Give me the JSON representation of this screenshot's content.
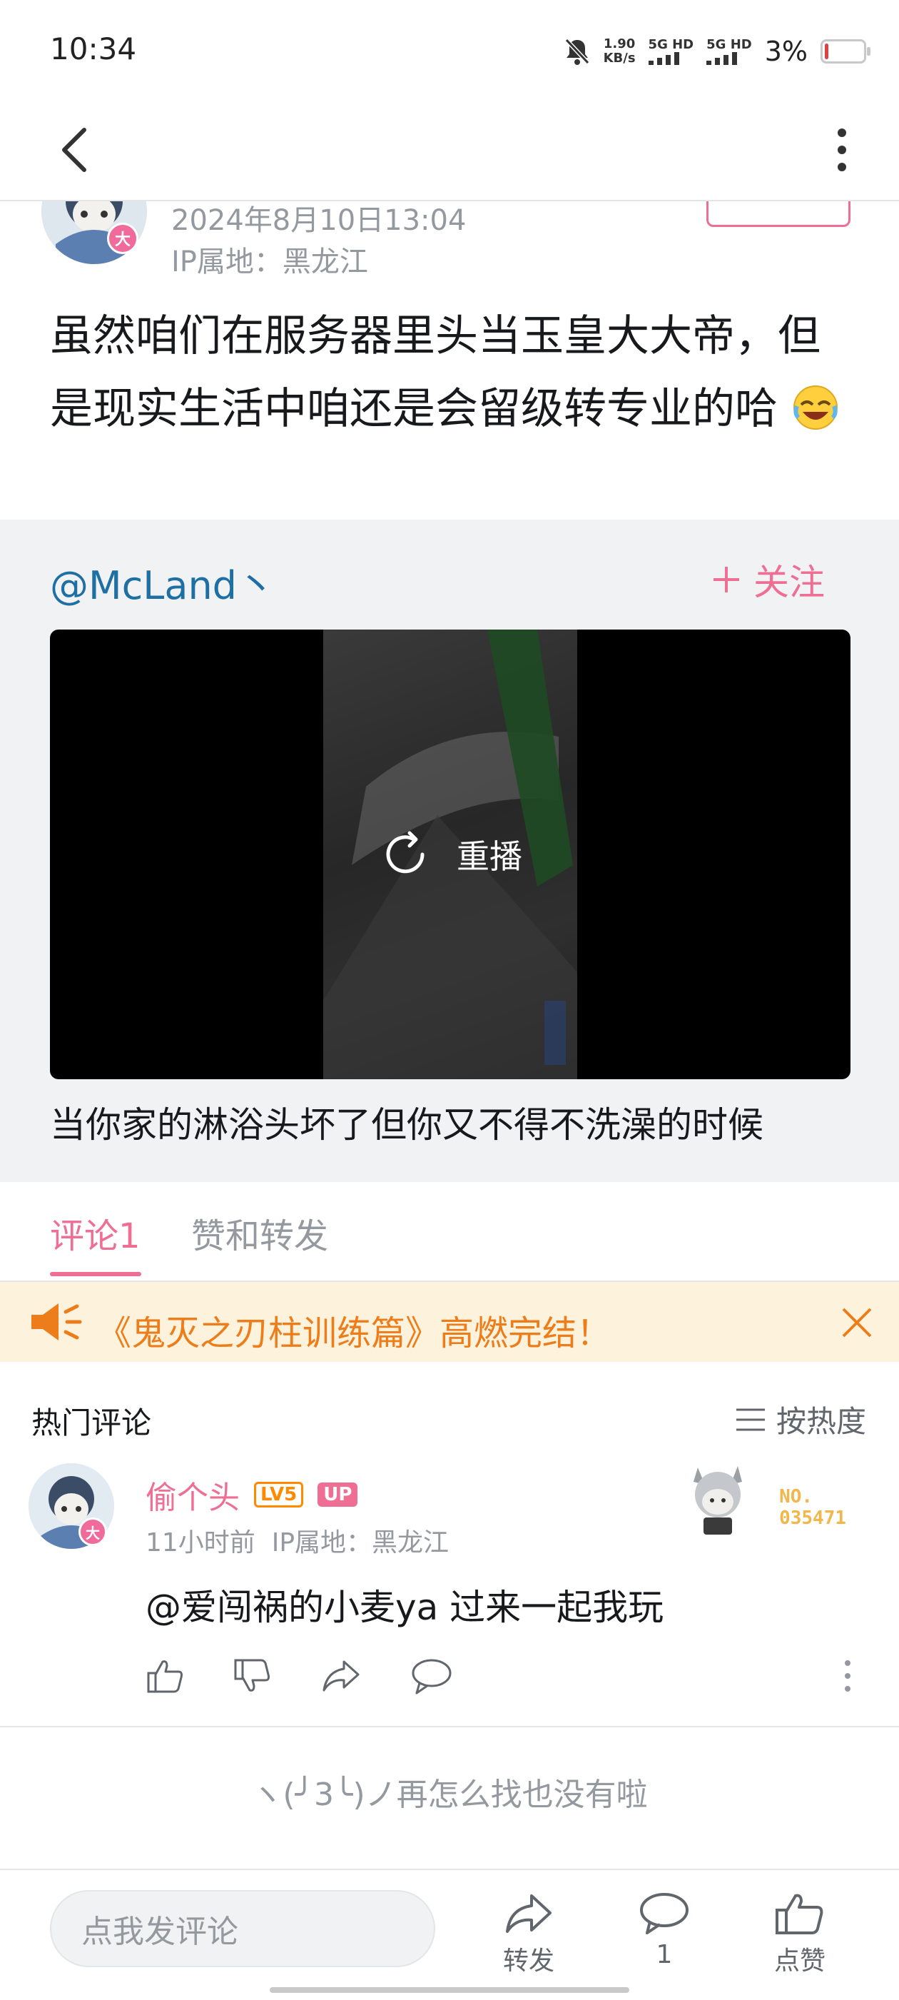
{
  "status_bar": {
    "time": "10:34",
    "net_speed_value": "1.90",
    "net_speed_unit": "KB/s",
    "signal_1": "5G HD",
    "signal_2": "5G HD",
    "battery": "3%",
    "battery_level": 0.03,
    "battery_color": "#e04040"
  },
  "nav": {
    "back_icon": "chevron-left-icon",
    "more_icon": "more-vertical-icon"
  },
  "post": {
    "date": "2024年8月10日13:04",
    "ip": "IP属地：黑龙江",
    "avatar_badge": "大",
    "text": "虽然咱们在服务器里头当玉皇大大帝，但是现实生活中咱还是会留级转专业的哈",
    "emoji_icon": "laughing-crying-emoji-icon"
  },
  "repost": {
    "author": "@McLand丶",
    "follow_label": "关注",
    "video_overlay_label": "重播",
    "video_caption": "当你家的淋浴头坏了但你又不得不洗澡的时候"
  },
  "tabs": [
    {
      "label": "评论",
      "count": "1",
      "active": true
    },
    {
      "label": "赞和转发",
      "active": false
    }
  ],
  "banner": {
    "text": "《鬼灭之刃柱训练篇》高燃完结！",
    "icon": "speaker-icon"
  },
  "comments_section": {
    "title": "热门评论",
    "sort_label": "按热度"
  },
  "comment": {
    "username": "偷个头",
    "level_badge": "LV5",
    "up_badge": "UP",
    "avatar_badge": "大",
    "time": "11小时前",
    "ip": "IP属地：黑龙江",
    "text": "@爱闯祸的小麦ya 过来一起我玩",
    "fan_no_label": "NO.",
    "fan_no_value": "035471"
  },
  "end_message": "ヽ(╯3╰)ノ再怎么找也没有啦",
  "bottom_bar": {
    "input_placeholder": "点我发评论",
    "share_label": "转发",
    "comment_count": "1",
    "like_label": "点赞"
  },
  "colors": {
    "accent_pink": "#ee6e94",
    "link_blue": "#1e6fa3",
    "banner_orange": "#ed7d1a",
    "banner_bg": "#fdf3dd"
  }
}
